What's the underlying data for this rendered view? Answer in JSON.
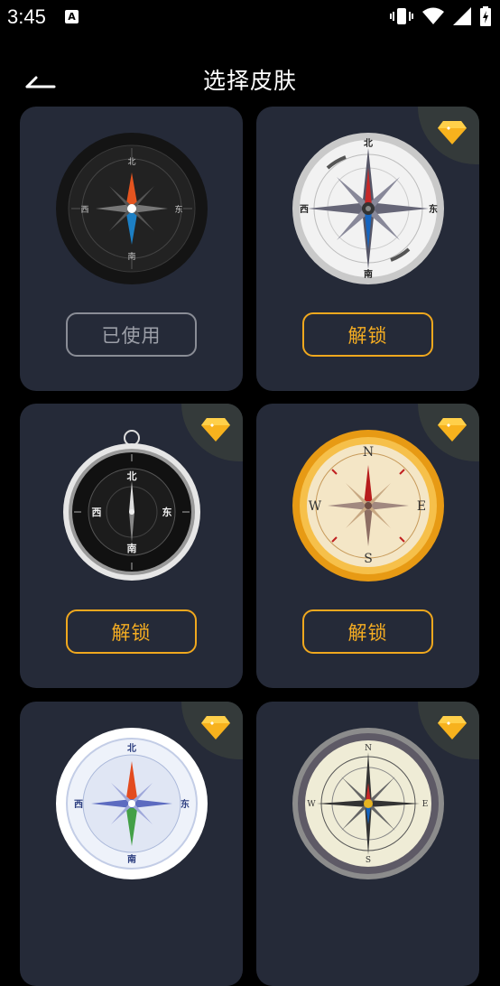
{
  "status": {
    "time": "3:45",
    "a_badge": "A"
  },
  "header": {
    "title": "选择皮肤"
  },
  "skins": [
    {
      "button_label": "已使用",
      "state": "used",
      "marks": [
        "北",
        "东",
        "南",
        "西"
      ]
    },
    {
      "button_label": "解锁",
      "state": "locked",
      "marks": [
        "北",
        "东",
        "南",
        "西"
      ]
    },
    {
      "button_label": "解锁",
      "state": "locked",
      "marks": [
        "北",
        "东",
        "南",
        "西"
      ]
    },
    {
      "button_label": "解锁",
      "state": "locked",
      "marks": [
        "N",
        "E",
        "S",
        "W"
      ]
    },
    {
      "button_label": "",
      "state": "locked",
      "marks": [
        "北",
        "东",
        "南",
        "西"
      ]
    },
    {
      "button_label": "",
      "state": "locked",
      "marks": [
        "N",
        "E",
        "S",
        "W"
      ]
    }
  ],
  "colors": {
    "accent": "#f5ad22",
    "card": "#252a38",
    "background": "#000000"
  }
}
